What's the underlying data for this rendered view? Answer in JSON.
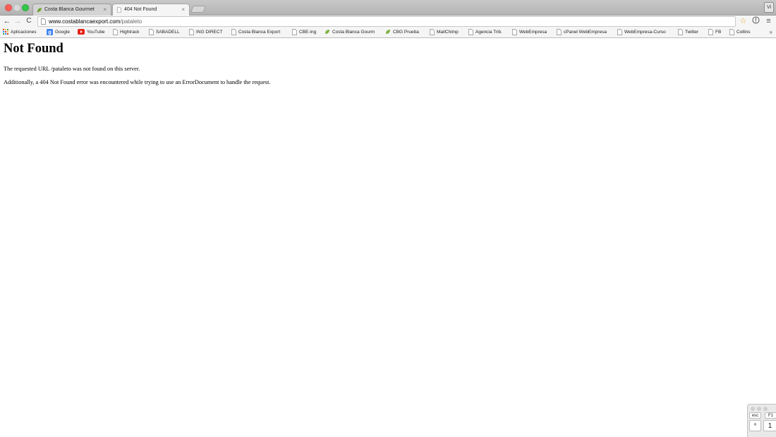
{
  "browser": {
    "tabs": [
      {
        "title": "Costa Blanca Gourmet",
        "close": "×",
        "favicon": "leaf-favicon"
      },
      {
        "title": "404 Not Found",
        "close": "×",
        "favicon": "page-icon"
      }
    ],
    "profile_label": "Vi",
    "address_bar": {
      "host": "www.costablancaexport.com",
      "path": "/pataleto"
    },
    "bookmarks": [
      {
        "label": "Aplicaciones",
        "icon": "apps-grid-icon"
      },
      {
        "label": "Google",
        "icon": "google-icon"
      },
      {
        "label": "YouTube",
        "icon": "youtube-icon"
      },
      {
        "label": "Hightrack",
        "icon": "page-icon"
      },
      {
        "label": "SABADELL",
        "icon": "page-icon"
      },
      {
        "label": "ING DIRECT",
        "icon": "page-icon"
      },
      {
        "label": "Costa Blanca Export",
        "icon": "page-icon"
      },
      {
        "label": "CBE-ing",
        "icon": "page-icon"
      },
      {
        "label": "Costa Blanca Gourm",
        "icon": "leaf-favicon"
      },
      {
        "label": "CBG Prueba",
        "icon": "leaf-favicon"
      },
      {
        "label": "MailChimp",
        "icon": "page-icon"
      },
      {
        "label": "Agencia Trib.",
        "icon": "page-icon"
      },
      {
        "label": "WebEmpresa",
        "icon": "page-icon"
      },
      {
        "label": "cPanel WebEmpresa",
        "icon": "page-icon"
      },
      {
        "label": "WebEmpresa-Curso",
        "icon": "page-icon"
      },
      {
        "label": "Twitter",
        "icon": "page-icon"
      },
      {
        "label": "FB",
        "icon": "page-icon"
      },
      {
        "label": "Collins",
        "icon": "page-icon"
      }
    ],
    "bookmarks_overflow": "»"
  },
  "page": {
    "heading": "Not Found",
    "paragraph_1": "The requested URL /pataleto was not found on this server.",
    "paragraph_2": "Additionally, a 404 Not Found error was encountered while trying to use an ErrorDocument to handle the request."
  },
  "keyboard_viewer": {
    "keys": [
      "esc",
      "F1",
      "º",
      "1"
    ]
  },
  "colors": {
    "close_red": "#fc5f57",
    "zoom_green": "#34c84a",
    "star": "#e7a92a",
    "youtube_red": "#e62117",
    "google_blue": "#4285f4",
    "leaf_green": "#7cb342"
  }
}
